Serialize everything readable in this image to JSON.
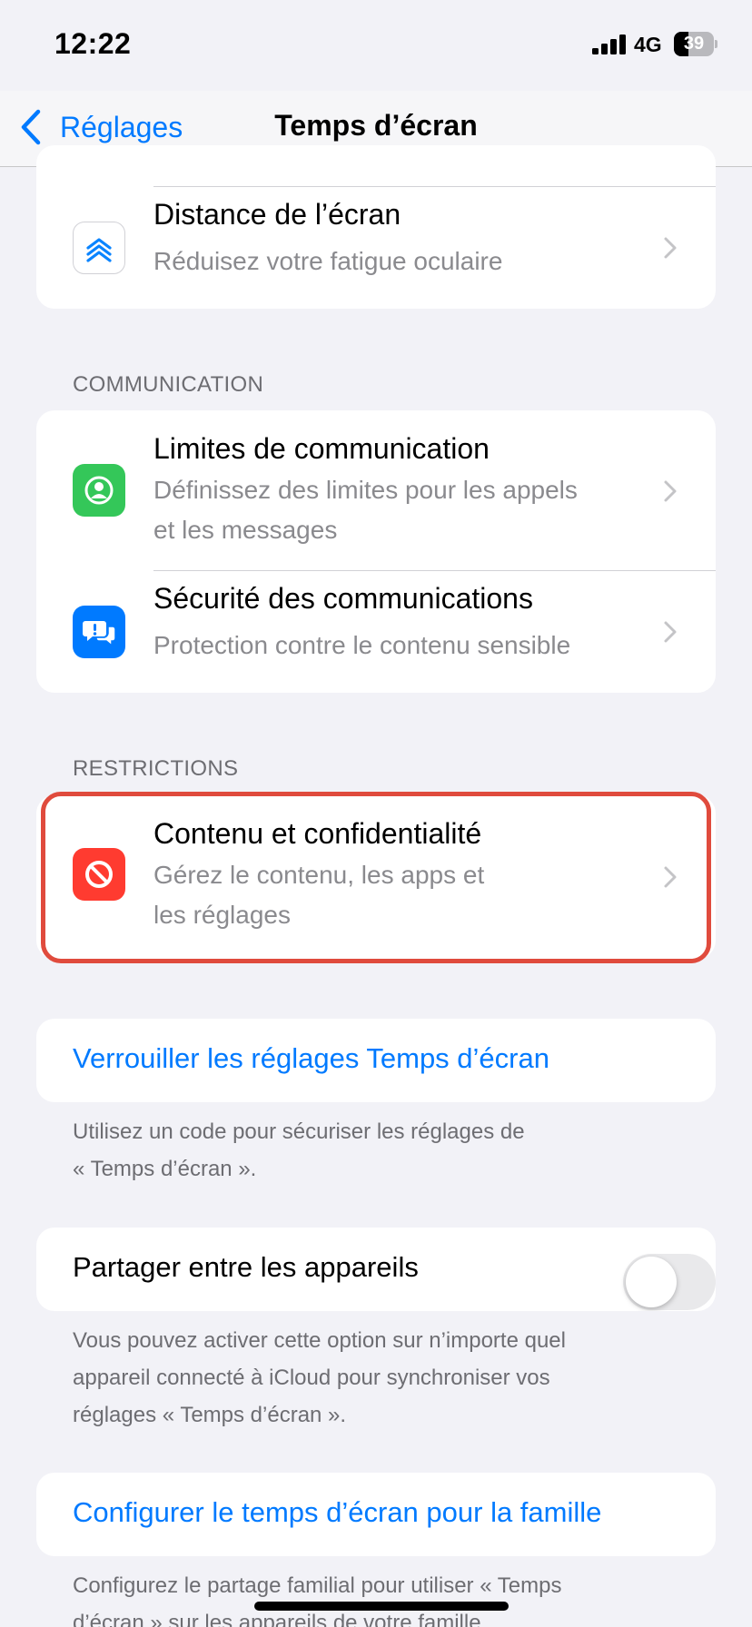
{
  "status_bar": {
    "time": "12:22",
    "network": "4G",
    "battery": "39"
  },
  "nav": {
    "back_label": "Réglages",
    "title": "Temps d’écran"
  },
  "distance_card": {
    "title": "Distance de l’écran",
    "subtitle": "Réduisez votre fatigue oculaire"
  },
  "communication": {
    "header": "COMMUNICATION",
    "items": [
      {
        "title": "Limites de communication",
        "subtitle_line1": "Définissez des limites pour les appels",
        "subtitle_line2": "et les messages"
      },
      {
        "title": "Sécurité des communications",
        "subtitle_line1": "Protection contre le contenu sensible"
      }
    ]
  },
  "restrictions": {
    "header": "RESTRICTIONS",
    "item": {
      "title": "Contenu et confidentialité",
      "subtitle_line1": "Gérez le contenu, les apps et",
      "subtitle_line2": "les réglages"
    }
  },
  "lock": {
    "label": "Verrouiller les réglages Temps d’écran",
    "footer_line1": "Utilisez un code pour sécuriser les réglages de",
    "footer_line2": "« Temps d’écran »."
  },
  "share": {
    "label": "Partager entre les appareils",
    "enabled": false,
    "footer_line1": "Vous pouvez activer cette option sur n’importe quel",
    "footer_line2": "appareil connecté à iCloud pour synchroniser vos",
    "footer_line3": "réglages « Temps d’écran »."
  },
  "family": {
    "label": "Configurer le temps d’écran pour la famille",
    "footer_line1": "Configurez le partage familial pour utiliser « Temps",
    "footer_line2": "d’écran » sur les appareils de votre famille."
  },
  "colors": {
    "accent": "#007aff",
    "highlight": "#e04b3d",
    "green": "#34c759",
    "blue": "#007aff",
    "red": "#ff3b30"
  }
}
